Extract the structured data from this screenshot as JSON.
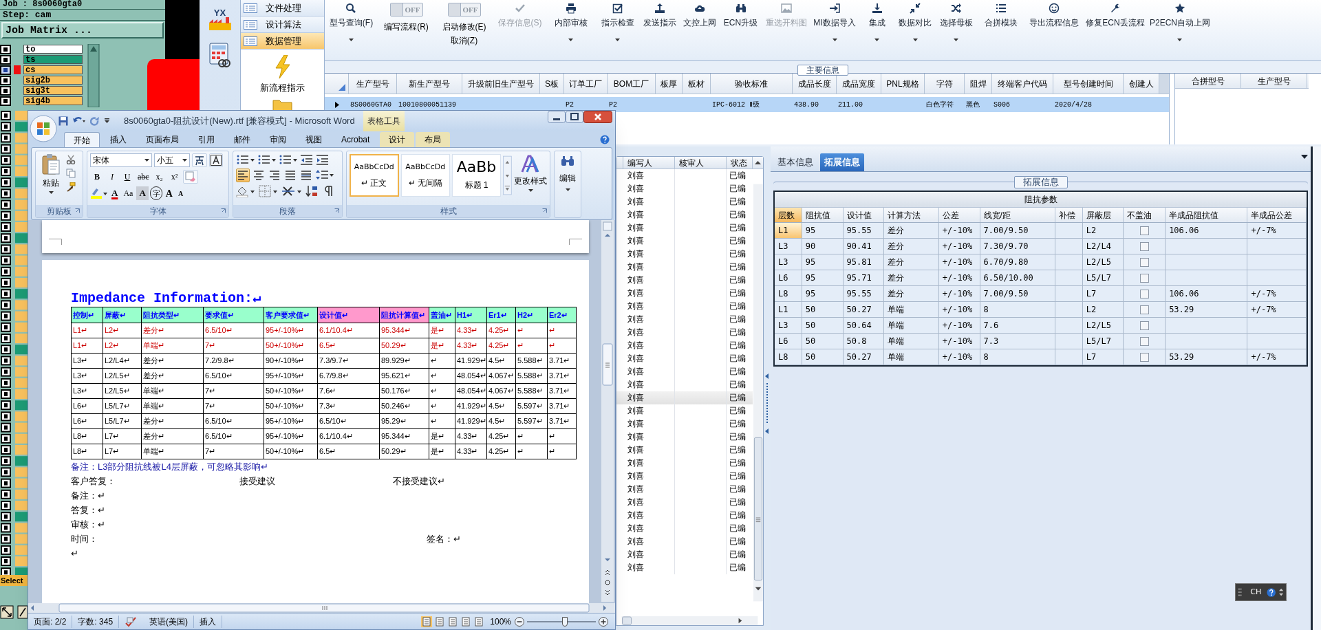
{
  "cam": {
    "job": "Job : 8s0060gta0",
    "step": "Step: cam",
    "matrix_button": "Job Matrix ...",
    "layers": [
      {
        "name": "to",
        "color": "#ffffff",
        "selected": false
      },
      {
        "name": "ts",
        "color": "#1c9b75",
        "selected": false
      },
      {
        "name": "cs",
        "color": "#f9c25e",
        "selected": true
      },
      {
        "name": "sig2b",
        "color": "#f9c25e",
        "selected": false
      },
      {
        "name": "sig3t",
        "color": "#f9c25e",
        "selected": false
      },
      {
        "name": "sig4b",
        "color": "#f9c25e",
        "selected": false
      }
    ],
    "select_label": "Select"
  },
  "app": {
    "logo_text": "YX",
    "nav": [
      {
        "label": "文件处理",
        "selected": false
      },
      {
        "label": "设计算法",
        "selected": false
      },
      {
        "label": "数据管理",
        "selected": true
      }
    ],
    "flow_item": "新流程指示",
    "toolbar": [
      {
        "kind": "button",
        "label": "型号查询(F)",
        "dropdown": true,
        "disabled": false
      },
      {
        "kind": "toggle",
        "switch": "OFF",
        "on": false,
        "label": "编写流程(R)"
      },
      {
        "kind": "toggle",
        "switch": "OFF",
        "on": false,
        "label": "启动修改(E)",
        "sublabel": "取消(Z)"
      },
      {
        "kind": "button",
        "label": "保存信息(S)",
        "dropdown": false,
        "disabled": true
      },
      {
        "kind": "button",
        "label": "内部审核",
        "dropdown": true,
        "disabled": false
      },
      {
        "kind": "button",
        "label": "指示检查",
        "dropdown": true,
        "disabled": false
      },
      {
        "kind": "button",
        "label": "发送指示",
        "dropdown": false,
        "disabled": false
      },
      {
        "kind": "button",
        "label": "文控上网",
        "dropdown": false,
        "disabled": false
      },
      {
        "kind": "button",
        "label": "ECN升级",
        "dropdown": false,
        "disabled": false
      },
      {
        "kind": "button",
        "label": "重选开料图",
        "dropdown": false,
        "disabled": true
      },
      {
        "kind": "button",
        "label": "MI数据导入",
        "dropdown": true,
        "disabled": false
      },
      {
        "kind": "button",
        "label": "集成",
        "dropdown": true,
        "disabled": false
      },
      {
        "kind": "button",
        "label": "数据对比",
        "dropdown": true,
        "disabled": false
      },
      {
        "kind": "button",
        "label": "选择母板",
        "dropdown": true,
        "disabled": false
      },
      {
        "kind": "button",
        "label": "合拼模块",
        "dropdown": false,
        "disabled": false
      },
      {
        "kind": "button",
        "label": "导出流程信息",
        "dropdown": false,
        "disabled": false
      },
      {
        "kind": "button",
        "label": "修复ECN丢流程",
        "dropdown": false,
        "disabled": false
      },
      {
        "kind": "button",
        "label": "P2ECN自动上网",
        "dropdown": true,
        "disabled": false
      }
    ],
    "main_info": {
      "title": "主要信息",
      "columns": [
        "生产型号",
        "新生产型号",
        "升级前旧生产型号",
        "S板",
        "订单工厂",
        "BOM工厂",
        "板厚",
        "板材",
        "验收标准",
        "成品长度",
        "成品宽度",
        "PNL规格",
        "字符",
        "阻焊",
        "终端客户代码",
        "型号创建时间",
        "创建人"
      ],
      "rows": [
        {
          "selected": true,
          "cells": [
            "8S0060GTA0",
            "10010800051139",
            null,
            null,
            "P2",
            "P2",
            null,
            null,
            "IPC-6012 Ⅱ级",
            "438.90",
            "211.00",
            null,
            "白色字符",
            "黑色",
            "S006",
            "2020/4/28",
            null
          ]
        }
      ],
      "side_columns": [
        "合拼型号",
        "生产型号"
      ]
    },
    "list": {
      "columns": [
        "编写人",
        "核审人",
        "状态"
      ],
      "rows": [
        {
          "writer": "刘喜",
          "status": "已编",
          "selected": false
        },
        {
          "writer": "刘喜",
          "status": "已编",
          "selected": false
        },
        {
          "writer": "刘喜",
          "status": "已编",
          "selected": false
        },
        {
          "writer": "刘喜",
          "status": "已编",
          "selected": false
        },
        {
          "writer": "刘喜",
          "status": "已编",
          "selected": false
        },
        {
          "writer": "刘喜",
          "status": "已编",
          "selected": false
        },
        {
          "writer": "刘喜",
          "status": "已编",
          "selected": false
        },
        {
          "writer": "刘喜",
          "status": "已编",
          "selected": false
        },
        {
          "writer": "刘喜",
          "status": "已编",
          "selected": false
        },
        {
          "writer": "刘喜",
          "status": "已编",
          "selected": false
        },
        {
          "writer": "刘喜",
          "status": "已编",
          "selected": false
        },
        {
          "writer": "刘喜",
          "status": "已编",
          "selected": false
        },
        {
          "writer": "刘喜",
          "status": "已编",
          "selected": false
        },
        {
          "writer": "刘喜",
          "status": "已编",
          "selected": false
        },
        {
          "writer": "刘喜",
          "status": "已编",
          "selected": false
        },
        {
          "writer": "刘喜",
          "status": "已编",
          "selected": false
        },
        {
          "writer": "刘喜",
          "status": "已编",
          "selected": false
        },
        {
          "writer": "刘喜",
          "status": "已编",
          "selected": true
        },
        {
          "writer": "刘喜",
          "status": "已编",
          "selected": false
        },
        {
          "writer": "刘喜",
          "status": "已编",
          "selected": false
        },
        {
          "writer": "刘喜",
          "status": "已编",
          "selected": false
        },
        {
          "writer": "刘喜",
          "status": "已编",
          "selected": false
        },
        {
          "writer": "刘喜",
          "status": "已编",
          "selected": false
        },
        {
          "writer": "刘喜",
          "status": "已编",
          "selected": false
        },
        {
          "writer": "刘喜",
          "status": "已编",
          "selected": false
        },
        {
          "writer": "刘喜",
          "status": "已编",
          "selected": false
        },
        {
          "writer": "刘喜",
          "status": "已编",
          "selected": false
        },
        {
          "writer": "刘喜",
          "status": "已编",
          "selected": false
        },
        {
          "writer": "刘喜",
          "status": "已编",
          "selected": false
        },
        {
          "writer": "刘喜",
          "status": "已编",
          "selected": false
        },
        {
          "writer": "刘喜",
          "status": "已编",
          "selected": false
        }
      ]
    },
    "detail": {
      "tabs": [
        {
          "label": "基本信息",
          "selected": false
        },
        {
          "label": "拓展信息",
          "selected": true
        }
      ],
      "group_title": "拓展信息",
      "caption": "阻抗参数",
      "columns": [
        {
          "label": "层数",
          "selected": true
        },
        {
          "label": "阻抗值",
          "selected": false
        },
        {
          "label": "设计值",
          "selected": false
        },
        {
          "label": "计算方法",
          "selected": false
        },
        {
          "label": "公差",
          "selected": false
        },
        {
          "label": "线宽/距",
          "selected": false
        },
        {
          "label": "补偿",
          "selected": false
        },
        {
          "label": "屏蔽层",
          "selected": false
        },
        {
          "label": "不盖油",
          "selected": false
        },
        {
          "label": "半成品阻抗值",
          "selected": false
        },
        {
          "label": "半成品公差",
          "selected": false
        }
      ],
      "rows": [
        {
          "selected": true,
          "cells": [
            "L1",
            "95",
            "95.55",
            "差分",
            "+/-10%",
            "7.00/9.50",
            null,
            "L2",
            null,
            "106.06",
            "+/-7%"
          ],
          "no_oil": false
        },
        {
          "selected": false,
          "cells": [
            "L3",
            "90",
            "90.41",
            "差分",
            "+/-10%",
            "7.30/9.70",
            null,
            "L2/L4",
            null,
            null,
            null
          ],
          "no_oil": false
        },
        {
          "selected": false,
          "cells": [
            "L3",
            "95",
            "95.81",
            "差分",
            "+/-10%",
            "6.70/9.80",
            null,
            "L2/L5",
            null,
            null,
            null
          ],
          "no_oil": false
        },
        {
          "selected": false,
          "cells": [
            "L6",
            "95",
            "95.71",
            "差分",
            "+/-10%",
            "6.50/10.00",
            null,
            "L5/L7",
            null,
            null,
            null
          ],
          "no_oil": false
        },
        {
          "selected": false,
          "cells": [
            "L8",
            "95",
            "95.55",
            "差分",
            "+/-10%",
            "7.00/9.50",
            null,
            "L7",
            null,
            "106.06",
            "+/-7%"
          ],
          "no_oil": false
        },
        {
          "selected": false,
          "cells": [
            "L1",
            "50",
            "50.27",
            "单端",
            "+/-10%",
            "8",
            null,
            "L2",
            null,
            "53.29",
            "+/-7%"
          ],
          "no_oil": false
        },
        {
          "selected": false,
          "cells": [
            "L3",
            "50",
            "50.64",
            "单端",
            "+/-10%",
            "7.6",
            null,
            "L2/L5",
            null,
            null,
            null
          ],
          "no_oil": false
        },
        {
          "selected": false,
          "cells": [
            "L6",
            "50",
            "50.8",
            "单端",
            "+/-10%",
            "7.3",
            null,
            "L5/L7",
            null,
            null,
            null
          ],
          "no_oil": false
        },
        {
          "selected": false,
          "cells": [
            "L8",
            "50",
            "50.27",
            "单端",
            "+/-10%",
            "8",
            null,
            "L7",
            null,
            "53.29",
            "+/-7%"
          ],
          "no_oil": false
        }
      ]
    },
    "ime": "CH"
  },
  "word": {
    "title": "8s0060gta0-阻抗设计(New).rtf [兼容模式] - Microsoft Word",
    "context_title": "表格工具",
    "tabs": [
      {
        "label": "开始",
        "selected": true,
        "contextual": false
      },
      {
        "label": "插入",
        "selected": false,
        "contextual": false
      },
      {
        "label": "页面布局",
        "selected": false,
        "contextual": false
      },
      {
        "label": "引用",
        "selected": false,
        "contextual": false
      },
      {
        "label": "邮件",
        "selected": false,
        "contextual": false
      },
      {
        "label": "审阅",
        "selected": false,
        "contextual": false
      },
      {
        "label": "视图",
        "selected": false,
        "contextual": false
      },
      {
        "label": "Acrobat",
        "selected": false,
        "contextual": false
      },
      {
        "label": "设计",
        "selected": false,
        "contextual": true
      },
      {
        "label": "布局",
        "selected": false,
        "contextual": true
      }
    ],
    "groups": [
      "剪贴板",
      "字体",
      "段落",
      "样式"
    ],
    "paste": "粘贴",
    "font": "宋体",
    "size": "小五",
    "font_buttons": [
      "B",
      "I",
      "U",
      "abc",
      "x₂",
      "x²"
    ],
    "font_buttons_2": [
      "A",
      "Aa",
      "A",
      "字",
      "A",
      "A"
    ],
    "alignment": [
      {
        "selected": true
      },
      {
        "selected": false
      },
      {
        "selected": false
      },
      {
        "selected": false
      },
      {
        "selected": false
      }
    ],
    "styles": [
      {
        "preview": "AaBbCcDd",
        "name": "↵ 正文",
        "selected": true
      },
      {
        "preview": "AaBbCcDd",
        "name": "↵ 无间隔",
        "selected": false
      },
      {
        "preview": "AaBb",
        "name": "标题 1",
        "selected": false
      }
    ],
    "change_styles": "更改样式",
    "editing": "编辑",
    "heading": "Impedance Information:↵",
    "table": {
      "header": [
        {
          "text": "控制↵",
          "color": "#99ffcc"
        },
        {
          "text": "屏蔽↵",
          "color": "#99ffcc"
        },
        {
          "text": "阻抗类型↵",
          "color": "#99ffcc"
        },
        {
          "text": "要求值↵",
          "color": "#99ffcc"
        },
        {
          "text": "客户要求值↵",
          "color": "#99ffcc"
        },
        {
          "text": "设计值↵",
          "color": "#ff99cc"
        },
        {
          "text": "阻抗计算值↵",
          "color": "#ff99cc"
        },
        {
          "text": "盖油↵",
          "color": "#99ffcc"
        },
        {
          "text": "H1↵",
          "color": "#99ffcc"
        },
        {
          "text": "Er1↵",
          "color": "#99ffcc"
        },
        {
          "text": "H2↵",
          "color": "#99ffcc"
        },
        {
          "text": "Er2↵",
          "color": "#99ffcc"
        }
      ],
      "rows": [
        {
          "color": "#cc0000",
          "cells": [
            "L1↵",
            "L2↵",
            "差分↵",
            "6.5/10↵",
            "95+/-10%↵",
            "6.1/10.4↵",
            "95.344↵",
            "是↵",
            "4.33↵",
            "4.25↵",
            "↵",
            "↵"
          ]
        },
        {
          "color": "#cc0000",
          "cells": [
            "L1↵",
            "L2↵",
            "单端↵",
            "7↵",
            "50+/-10%↵",
            "6.5↵",
            "50.29↵",
            "是↵",
            "4.33↵",
            "4.25↵",
            "↵",
            "↵"
          ]
        },
        {
          "color": "#000000",
          "cells": [
            "L3↵",
            "L2/L4↵",
            "差分↵",
            "7.2/9.8↵",
            "90+/-10%↵",
            "7.3/9.7↵",
            "89.929↵",
            "↵",
            "41.929↵",
            "4.5↵",
            "5.588↵",
            "3.71↵"
          ]
        },
        {
          "color": "#000000",
          "cells": [
            "L3↵",
            "L2/L5↵",
            "差分↵",
            "6.5/10↵",
            "95+/-10%↵",
            "6.7/9.8↵",
            "95.621↵",
            "↵",
            "48.054↵",
            "4.067↵",
            "5.588↵",
            "3.71↵"
          ]
        },
        {
          "color": "#000000",
          "cells": [
            "L3↵",
            "L2/L5↵",
            "单端↵",
            "7↵",
            "50+/-10%↵",
            "7.6↵",
            "50.176↵",
            "↵",
            "48.054↵",
            "4.067↵",
            "5.588↵",
            "3.71↵"
          ]
        },
        {
          "color": "#000000",
          "cells": [
            "L6↵",
            "L5/L7↵",
            "单端↵",
            "7↵",
            "50+/-10%↵",
            "7.3↵",
            "50.246↵",
            "↵",
            "41.929↵",
            "4.5↵",
            "5.597↵",
            "3.71↵"
          ]
        },
        {
          "color": "#000000",
          "cells": [
            "L6↵",
            "L5/L7↵",
            "差分↵",
            "6.5/10↵",
            "95+/-10%↵",
            "6.5/10↵",
            "95.29↵",
            "↵",
            "41.929↵",
            "4.5↵",
            "5.597↵",
            "3.71↵"
          ]
        },
        {
          "color": "#000000",
          "cells": [
            "L8↵",
            "L7↵",
            "差分↵",
            "6.5/10↵",
            "95+/-10%↵",
            "6.1/10.4↵",
            "95.344↵",
            "是↵",
            "4.33↵",
            "4.25↵",
            "↵",
            "↵"
          ]
        },
        {
          "color": "#000000",
          "cells": [
            "L8↵",
            "L7↵",
            "单端↵",
            "7↵",
            "50+/-10%↵",
            "6.5↵",
            "50.29↵",
            "是↵",
            "4.33↵",
            "4.25↵",
            "↵",
            "↵"
          ]
        }
      ]
    },
    "notes": [
      {
        "kind": "remark",
        "parts": [
          "备注：L3部分阻抗线被L4层屏蔽，可忽略其影响↵"
        ]
      },
      {
        "kind": "line",
        "parts": [
          "客户答复：",
          "接受建议",
          "不接受建议↵"
        ]
      },
      {
        "kind": "line",
        "parts": [
          "备注：↵"
        ]
      },
      {
        "kind": "line",
        "parts": [
          "答复：↵"
        ]
      },
      {
        "kind": "line",
        "parts": [
          "审核：↵"
        ]
      },
      {
        "kind": "line",
        "parts": [
          "时间：",
          "签名：↵"
        ]
      },
      {
        "kind": "line",
        "parts": [
          "↵"
        ]
      }
    ],
    "status": [
      "页面: 2/2",
      "字数: 345",
      "英语(美国)",
      "插入"
    ],
    "zoom": "100%",
    "zoom_slider": {
      "level": 0.55
    }
  }
}
